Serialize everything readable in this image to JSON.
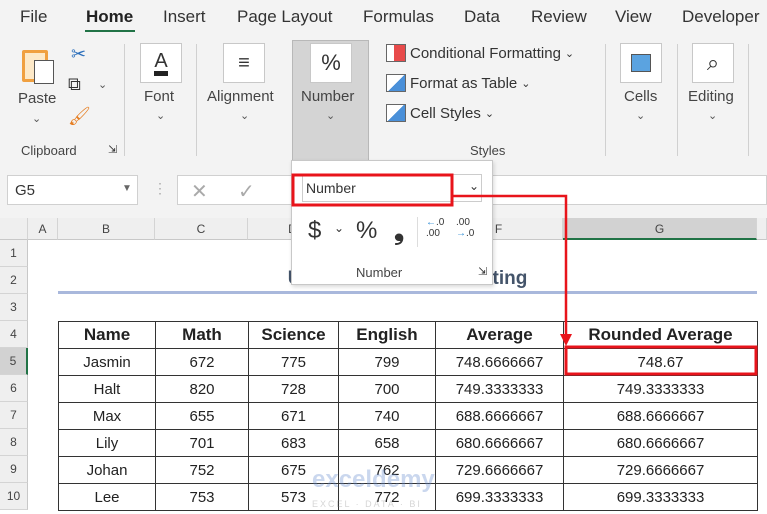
{
  "menu_tabs": [
    "File",
    "Home",
    "Insert",
    "Page Layout",
    "Formulas",
    "Data",
    "Review",
    "View",
    "Developer"
  ],
  "active_tab": "Home",
  "ribbon": {
    "clipboard": {
      "paste": "Paste",
      "group": "Clipboard"
    },
    "font": "Font",
    "alignment": "Alignment",
    "number": "Number",
    "styles": {
      "conditional": "Conditional Formatting",
      "table": "Format as Table",
      "cell_styles": "Cell Styles",
      "group": "Styles"
    },
    "cells": "Cells",
    "editing": "Editing"
  },
  "name_box": "G5",
  "number_panel": {
    "format_value": "Number",
    "currency": "$",
    "percent": "%",
    "comma": "❟",
    "group": "Number"
  },
  "columns": [
    "A",
    "B",
    "C",
    "D",
    "E",
    "F",
    "G"
  ],
  "rows": [
    "1",
    "2",
    "3",
    "4",
    "5",
    "6",
    "7",
    "8",
    "9",
    "10"
  ],
  "sheet_title": "Use of Number Formatting",
  "table": {
    "headers": [
      "Name",
      "Math",
      "Science",
      "English",
      "Average",
      "Rounded Average"
    ],
    "rows": [
      [
        "Jasmin",
        "672",
        "775",
        "799",
        "748.6666667",
        "748.67"
      ],
      [
        "Halt",
        "820",
        "728",
        "700",
        "749.3333333",
        "749.3333333"
      ],
      [
        "Max",
        "655",
        "671",
        "740",
        "688.6666667",
        "688.6666667"
      ],
      [
        "Lily",
        "701",
        "683",
        "658",
        "680.6666667",
        "680.6666667"
      ],
      [
        "Johan",
        "752",
        "675",
        "762",
        "729.6666667",
        "729.6666667"
      ],
      [
        "Lee",
        "753",
        "573",
        "772",
        "699.3333333",
        "699.3333333"
      ]
    ]
  },
  "watermark": {
    "brand": "exceldemy",
    "tagline": "EXCEL · DATA · BI"
  },
  "colors": {
    "accent_green": "#217346",
    "highlight_red": "#e8141b",
    "title_blue": "#44546a",
    "underline": "#a9b8dc"
  }
}
